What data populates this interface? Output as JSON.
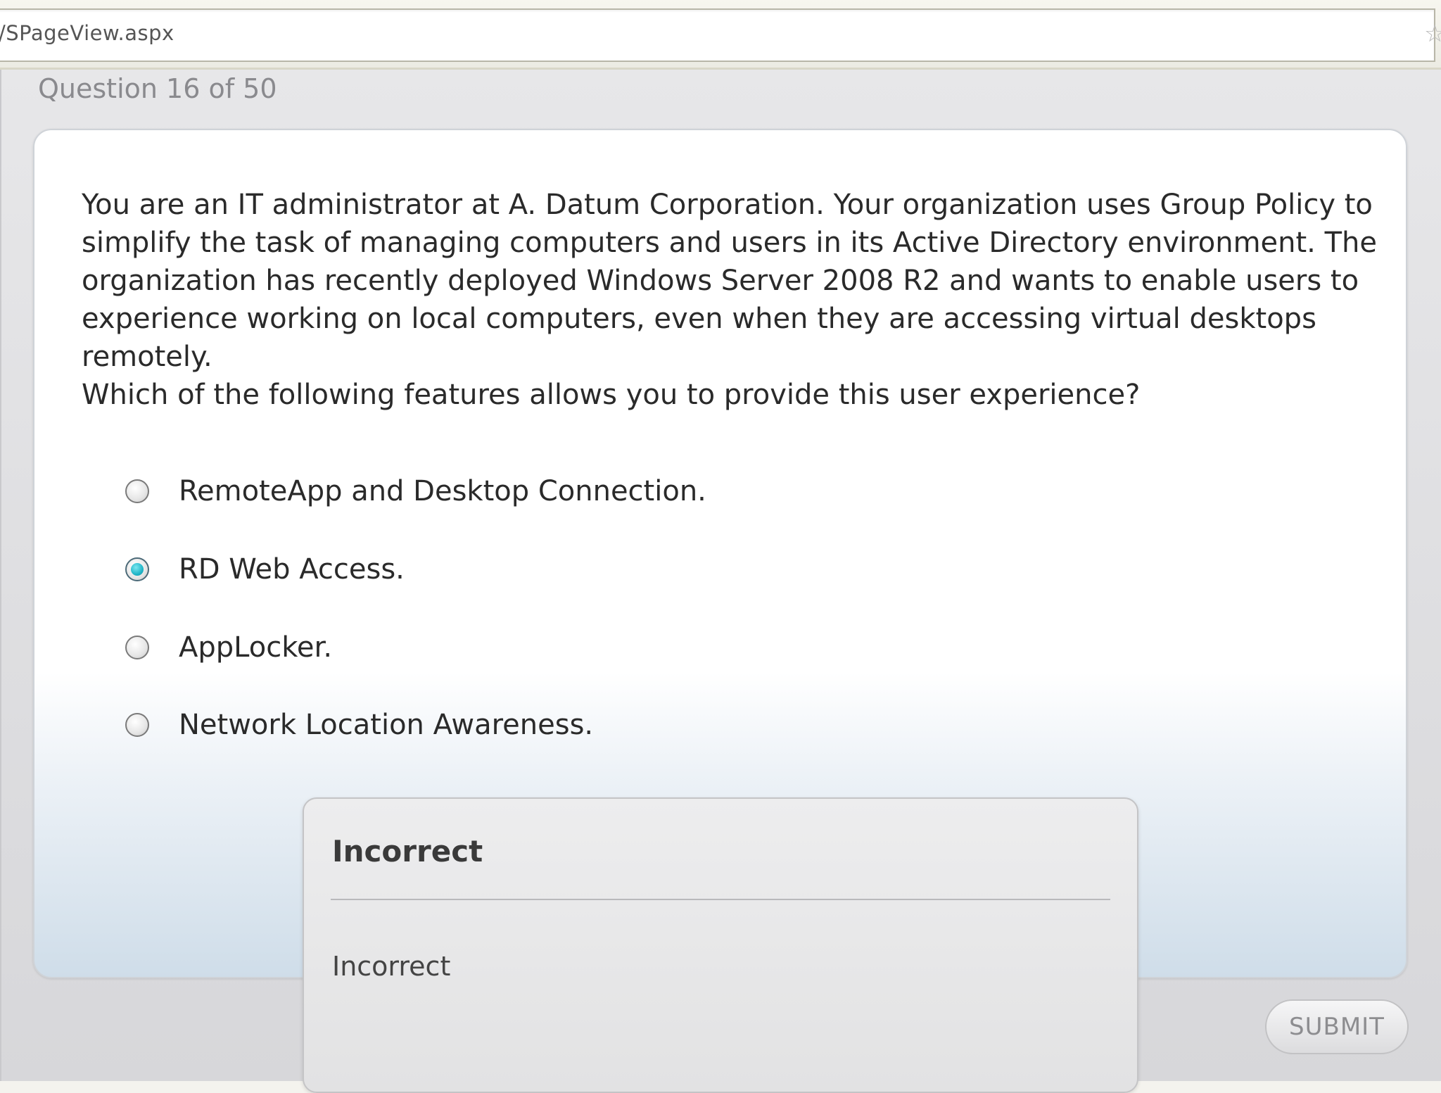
{
  "browser": {
    "address": "/SPageView.aspx",
    "address_icon": "favorites-star-icon"
  },
  "quiz": {
    "counter": "Question 16 of 50",
    "question": {
      "paragraph1": "You are an IT administrator at A. Datum Corporation. Your organization uses Group Policy to simplify the task of managing computers and users in its Active Directory environment. The organization has recently deployed Windows Server 2008 R2 and wants to enable users to experience working on local computers, even when they are accessing virtual desktops remotely.",
      "paragraph2": "Which of the following features allows you to provide this user experience?"
    },
    "options": [
      {
        "label": "RemoteApp and Desktop Connection.",
        "selected": false
      },
      {
        "label": "RD Web Access.",
        "selected": true
      },
      {
        "label": "AppLocker.",
        "selected": false
      },
      {
        "label": "Network Location Awareness.",
        "selected": false
      }
    ],
    "feedback": {
      "title": "Incorrect",
      "body": "Incorrect"
    },
    "submit_label": "SUBMIT"
  },
  "colors": {
    "selected_radio": "#21b6c8",
    "panel_gradient_bottom": "#cfdde9"
  }
}
